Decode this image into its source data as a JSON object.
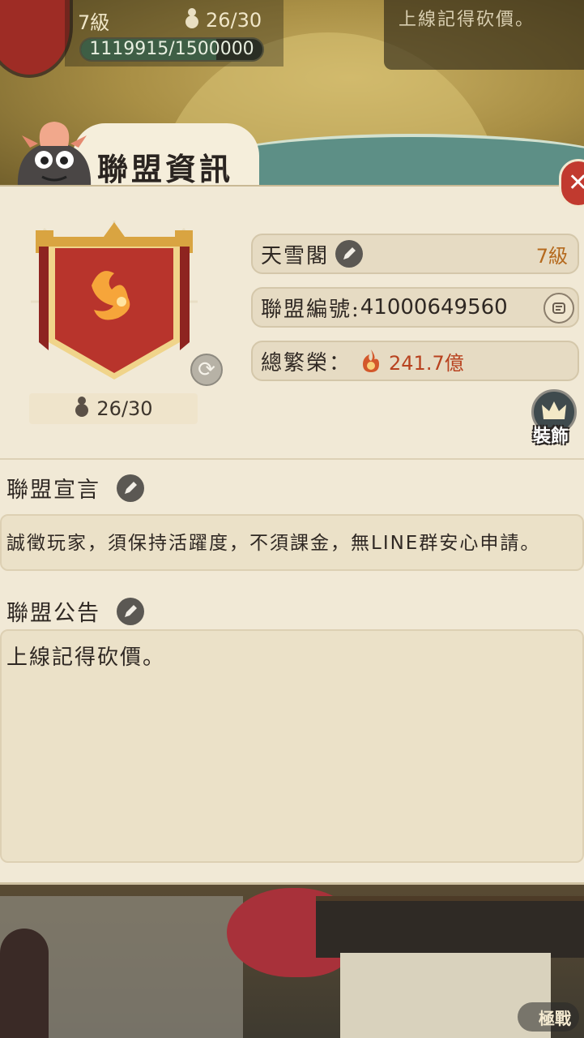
{
  "top": {
    "level": "7級",
    "members": "26/30",
    "exp_text": "1119915/1500000",
    "exp_fraction": 0.7466,
    "notice_preview": "上線記得砍價。"
  },
  "panel": {
    "title": "聯盟資訊",
    "close_symbol": "✕"
  },
  "alliance": {
    "name": "天雪閣",
    "level": "7級",
    "id_label": "聯盟編號:",
    "id_value": "41000649560",
    "prosperity_label": "總繁榮：",
    "prosperity_value": "241.7億",
    "member_count": "26/30",
    "decor_label": "裝飾"
  },
  "declaration": {
    "title": "聯盟宣言",
    "text": "誠徵玩家，須保持活躍度，不須課金，無LINE群安心申請。"
  },
  "announcement": {
    "title": "聯盟公告",
    "text": "上線記得砍價。"
  },
  "footer": {
    "battle_label": "極戰"
  },
  "colors": {
    "panel_bg": "#f1e9d6",
    "banner_red": "#b8342c",
    "banner_gold": "#d9a441",
    "level_orange": "#b56a1e",
    "prosperity_red": "#b8421f"
  },
  "icons": [
    "gourd-icon",
    "pen-icon",
    "copy-icon",
    "refresh-icon",
    "fire-icon",
    "crown-icon",
    "mascot-icon",
    "close-icon"
  ]
}
